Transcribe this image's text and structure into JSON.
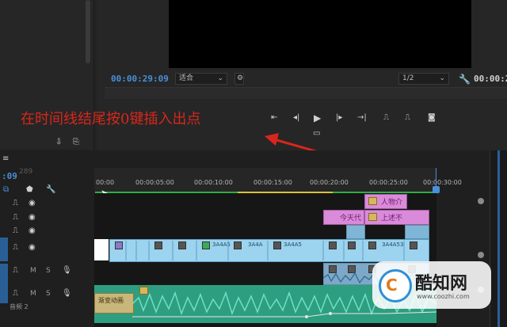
{
  "program_monitor": {
    "timecode": "00:00:29:09",
    "fit_label": "适合",
    "resolution": "1/2",
    "duration_timecode": "00:00:2"
  },
  "annotation": {
    "text": "在时间线结尾按0键插入出点"
  },
  "timeline": {
    "timecode": ":09",
    "ghost_timecode": "289",
    "ruler_ticks": [
      "00:00",
      "00:00:05:00",
      "00:00:10:00",
      "00:00:15:00",
      "00:00:20:00",
      "00:00:25:00",
      "00:00:30:00"
    ],
    "clip_labels": {
      "pink_1": "人物介",
      "pink_2": "今天代",
      "pink_3": "上述不",
      "video_1": "3A4A5",
      "video_2": "3A4A",
      "video_3": "3A4A5",
      "video_4": "3A4A53",
      "audio_1": "渐变动画"
    },
    "audio_track_label": "音频 2",
    "track_m": "M",
    "track_s": "S"
  },
  "watermark": {
    "name": "酷知网",
    "url": "www.coozhi.com"
  },
  "colors": {
    "accent_blue": "#4a8fd9",
    "annotation_red": "#d8261c",
    "video_clip": "#9cd3ee",
    "title_clip": "#d98ad9",
    "audio_wave": "#3fbfa0"
  }
}
